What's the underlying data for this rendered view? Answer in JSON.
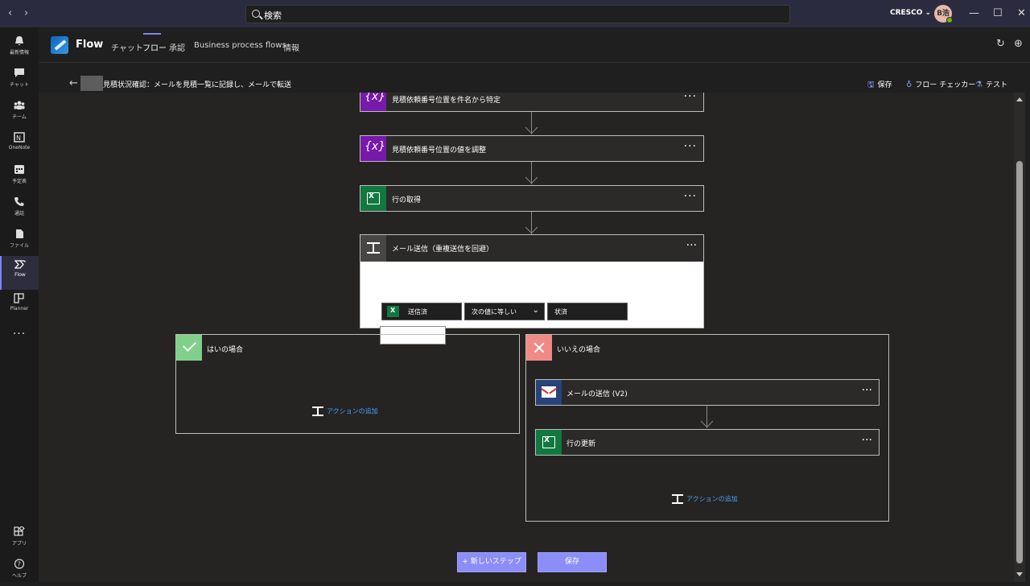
{
  "search": {
    "placeholder": "検索"
  },
  "account": {
    "tenant": "CRESCO ⌄",
    "initials": "B浩"
  },
  "rail": [
    {
      "label": "最新情報"
    },
    {
      "label": "チャット"
    },
    {
      "label": "チーム"
    },
    {
      "label": "OneNote"
    },
    {
      "label": "予定表"
    },
    {
      "label": "通話"
    },
    {
      "label": "ファイル"
    },
    {
      "label": "Flow"
    },
    {
      "label": "Planner"
    },
    {
      "label": "アプリ"
    },
    {
      "label": "ヘルプ"
    }
  ],
  "app": {
    "title": "Flow",
    "tabs": [
      "チャット",
      "フロー",
      "承認",
      "Business process flows",
      "情報"
    ],
    "active_tab": "フロー"
  },
  "breadcrumb": {
    "flow_name": "見積状況確認：メールを見積一覧に記録し、メールで転送"
  },
  "commands": {
    "save": "保存",
    "checker": "フロー チェッカー",
    "test": "テスト"
  },
  "steps": [
    {
      "title": "見積依頼番号位置を件名から特定",
      "icon": "variable-icon"
    },
    {
      "title": "見積依頼番号位置の値を調整",
      "icon": "variable-icon"
    },
    {
      "title": "行の取得",
      "icon": "excel-icon"
    }
  ],
  "condition": {
    "title": "メール送信（重複送信を回避）",
    "left_token": "送信済",
    "operator": "次の値に等しい",
    "right_value": "状済"
  },
  "yes_branch": {
    "title": "はいの場合",
    "add_action": "アクションの追加"
  },
  "no_branch": {
    "title": "いいえの場合",
    "steps": [
      {
        "title": "メールの送信 (V2)",
        "icon": "gmail-icon"
      },
      {
        "title": "行の更新",
        "icon": "excel-icon"
      }
    ],
    "add_action": "アクションの追加"
  },
  "footer": {
    "new_step": "+ 新しいステップ",
    "save": "保存"
  },
  "colors": {
    "accent": "#7f85f5",
    "variable": "#7719aa",
    "excel": "#117840",
    "yes": "#7ed08a",
    "no": "#f08a86",
    "link": "#479ef5"
  }
}
